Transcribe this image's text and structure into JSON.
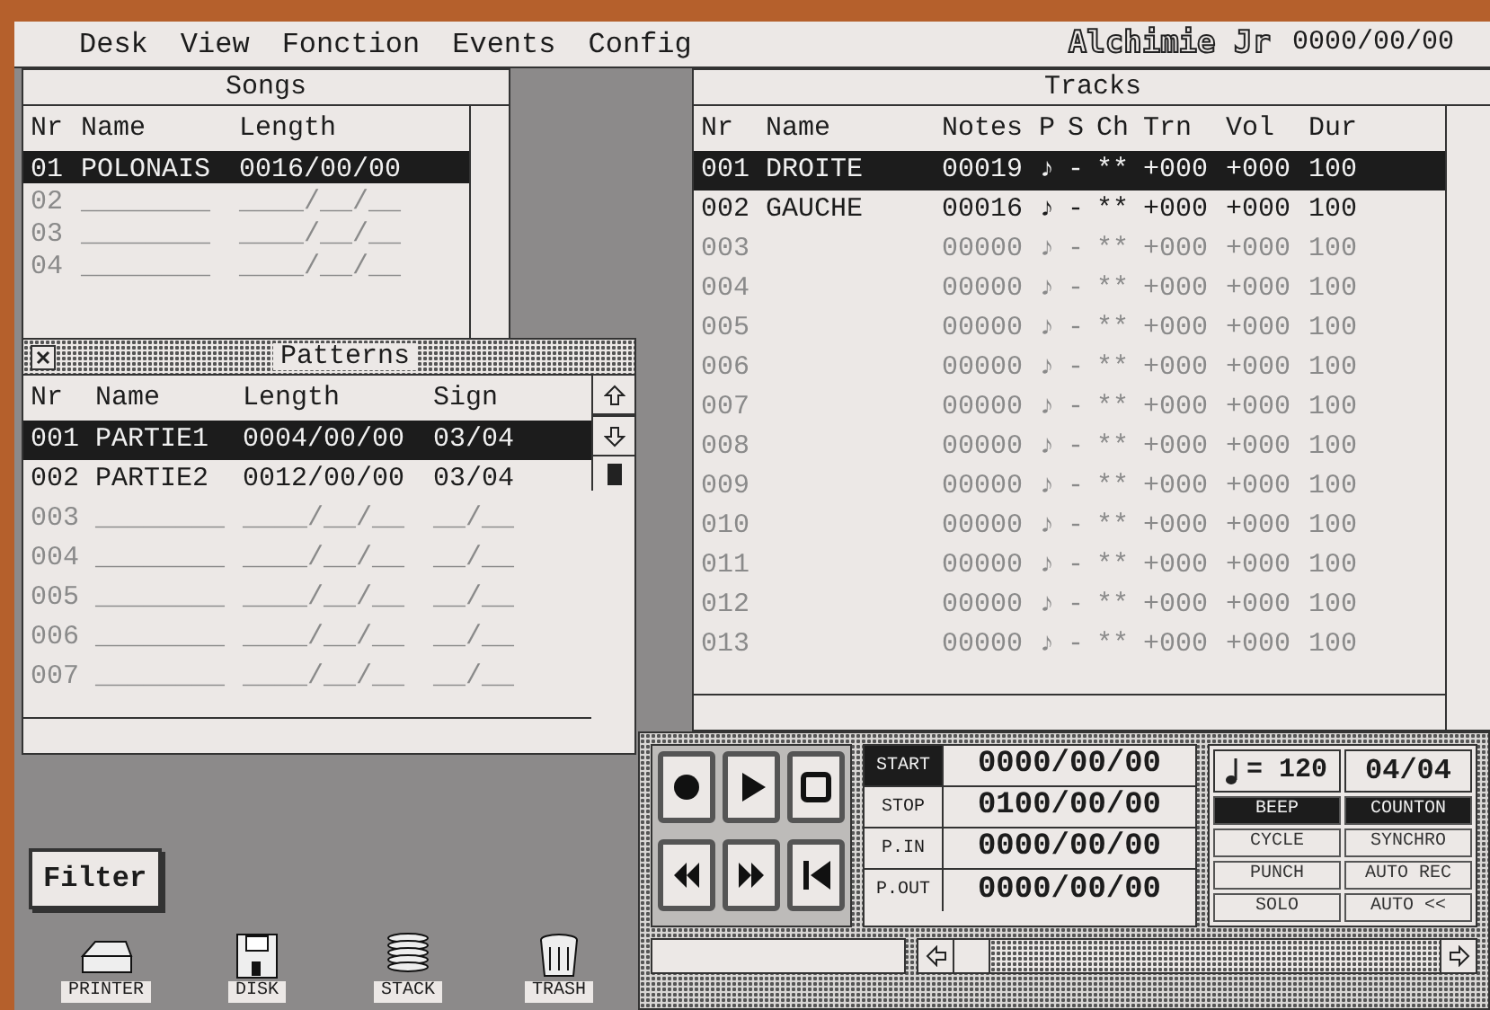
{
  "menu_bar": {
    "items": [
      "Desk",
      "View",
      "Fonction",
      "Events",
      "Config"
    ],
    "app_title": "Alchimie Jr",
    "time": "0000/00/00"
  },
  "songs": {
    "title": "Songs",
    "columns": [
      "Nr",
      "Name",
      "Length"
    ],
    "rows": [
      {
        "cells": [
          "01",
          "POLONAIS",
          "0016/00/00"
        ],
        "selected": true,
        "empty": false
      },
      {
        "cells": [
          "02",
          "________",
          "____/__/__"
        ],
        "selected": false,
        "empty": true
      },
      {
        "cells": [
          "03",
          "________",
          "____/__/__"
        ],
        "selected": false,
        "empty": true
      },
      {
        "cells": [
          "04",
          "________",
          "____/__/__"
        ],
        "selected": false,
        "empty": true
      }
    ]
  },
  "patterns": {
    "title": "Patterns",
    "columns": [
      "Nr",
      "Name",
      "Length",
      "Sign"
    ],
    "rows": [
      {
        "cells": [
          "001",
          "PARTIE1",
          "0004/00/00",
          "03/04"
        ],
        "selected": true,
        "empty": false
      },
      {
        "cells": [
          "002",
          "PARTIE2",
          "0012/00/00",
          "03/04"
        ],
        "selected": false,
        "empty": false
      },
      {
        "cells": [
          "003",
          "________",
          "____/__/__",
          "__/__"
        ],
        "selected": false,
        "empty": true
      },
      {
        "cells": [
          "004",
          "________",
          "____/__/__",
          "__/__"
        ],
        "selected": false,
        "empty": true
      },
      {
        "cells": [
          "005",
          "________",
          "____/__/__",
          "__/__"
        ],
        "selected": false,
        "empty": true
      },
      {
        "cells": [
          "006",
          "________",
          "____/__/__",
          "__/__"
        ],
        "selected": false,
        "empty": true
      },
      {
        "cells": [
          "007",
          "________",
          "____/__/__",
          "__/__"
        ],
        "selected": false,
        "empty": true
      }
    ]
  },
  "tracks": {
    "title": "Tracks",
    "columns": [
      "Nr",
      "Name",
      "Notes",
      "P",
      "S",
      "Ch",
      "Trn",
      "Vol",
      "Dur"
    ],
    "rows": [
      {
        "cells": [
          "001",
          "DROITE",
          "00019",
          "♪",
          "-",
          "**",
          "+000",
          "+000",
          "100"
        ],
        "selected": true,
        "empty": false
      },
      {
        "cells": [
          "002",
          "GAUCHE",
          "00016",
          "♪",
          "-",
          "**",
          "+000",
          "+000",
          "100"
        ],
        "selected": false,
        "empty": false
      },
      {
        "cells": [
          "003",
          "",
          "00000",
          "♪",
          "-",
          "**",
          "+000",
          "+000",
          "100"
        ],
        "selected": false,
        "empty": true
      },
      {
        "cells": [
          "004",
          "",
          "00000",
          "♪",
          "-",
          "**",
          "+000",
          "+000",
          "100"
        ],
        "selected": false,
        "empty": true
      },
      {
        "cells": [
          "005",
          "",
          "00000",
          "♪",
          "-",
          "**",
          "+000",
          "+000",
          "100"
        ],
        "selected": false,
        "empty": true
      },
      {
        "cells": [
          "006",
          "",
          "00000",
          "♪",
          "-",
          "**",
          "+000",
          "+000",
          "100"
        ],
        "selected": false,
        "empty": true
      },
      {
        "cells": [
          "007",
          "",
          "00000",
          "♪",
          "-",
          "**",
          "+000",
          "+000",
          "100"
        ],
        "selected": false,
        "empty": true
      },
      {
        "cells": [
          "008",
          "",
          "00000",
          "♪",
          "-",
          "**",
          "+000",
          "+000",
          "100"
        ],
        "selected": false,
        "empty": true
      },
      {
        "cells": [
          "009",
          "",
          "00000",
          "♪",
          "-",
          "**",
          "+000",
          "+000",
          "100"
        ],
        "selected": false,
        "empty": true
      },
      {
        "cells": [
          "010",
          "",
          "00000",
          "♪",
          "-",
          "**",
          "+000",
          "+000",
          "100"
        ],
        "selected": false,
        "empty": true
      },
      {
        "cells": [
          "011",
          "",
          "00000",
          "♪",
          "-",
          "**",
          "+000",
          "+000",
          "100"
        ],
        "selected": false,
        "empty": true
      },
      {
        "cells": [
          "012",
          "",
          "00000",
          "♪",
          "-",
          "**",
          "+000",
          "+000",
          "100"
        ],
        "selected": false,
        "empty": true
      },
      {
        "cells": [
          "013",
          "",
          "00000",
          "♪",
          "-",
          "**",
          "+000",
          "+000",
          "100"
        ],
        "selected": false,
        "empty": true
      }
    ]
  },
  "transport": {
    "buttons": [
      {
        "kind": "record"
      },
      {
        "kind": "play"
      },
      {
        "kind": "stop"
      },
      {
        "kind": "rewind"
      },
      {
        "kind": "forward"
      },
      {
        "kind": "to-start"
      }
    ],
    "positions": [
      {
        "label": "START",
        "value": "0000/00/00",
        "selected": true
      },
      {
        "label": "STOP",
        "value": "0100/00/00",
        "selected": false
      },
      {
        "label": "P.IN",
        "value": "0000/00/00",
        "selected": false
      },
      {
        "label": "P.OUT",
        "value": "0000/00/00",
        "selected": false
      }
    ],
    "tempo": "= 120",
    "signature": "04/04",
    "toggles": [
      {
        "label": "BEEP",
        "on": true
      },
      {
        "label": "COUNTON",
        "on": true
      },
      {
        "label": "CYCLE",
        "on": false
      },
      {
        "label": "SYNCHRO",
        "on": false
      },
      {
        "label": "PUNCH",
        "on": false
      },
      {
        "label": "AUTO REC",
        "on": false
      },
      {
        "label": "SOLO",
        "on": false
      },
      {
        "label": "AUTO <<",
        "on": false
      }
    ]
  },
  "desktop": {
    "filter_button": "Filter",
    "icons": [
      {
        "kind": "printer",
        "label": "PRINTER"
      },
      {
        "kind": "disk",
        "label": "DISK"
      },
      {
        "kind": "stack",
        "label": "STACK"
      },
      {
        "kind": "trash",
        "label": "TRASH"
      }
    ]
  }
}
